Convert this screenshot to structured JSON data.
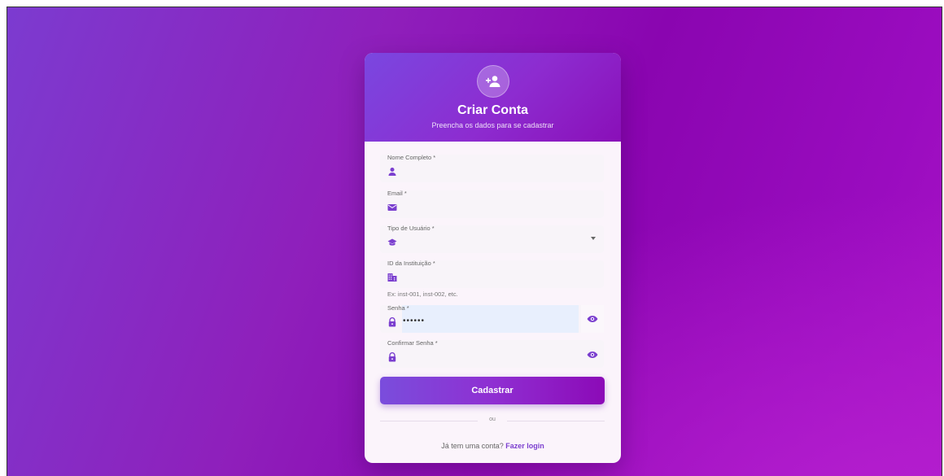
{
  "header": {
    "title": "Criar Conta",
    "subtitle": "Preencha os dados para se cadastrar",
    "icon": "person-add-icon"
  },
  "form": {
    "name_label": "Nome Completo *",
    "email_label": "Email *",
    "user_type_label": "Tipo de Usuário *",
    "institution_label": "ID da Instituição *",
    "institution_hint": "Ex: inst-001, inst-002, etc.",
    "password_label": "Senha *",
    "password_value": "••••••",
    "confirm_label": "Confirmar Senha *",
    "submit_label": "Cadastrar"
  },
  "divider_text": "ou",
  "footer": {
    "question": "Já tem uma conta?",
    "link": "Fazer login"
  },
  "colors": {
    "accent": "#7b3fcf",
    "background_start": "#7c3bd0",
    "background_end": "#a812c6"
  }
}
